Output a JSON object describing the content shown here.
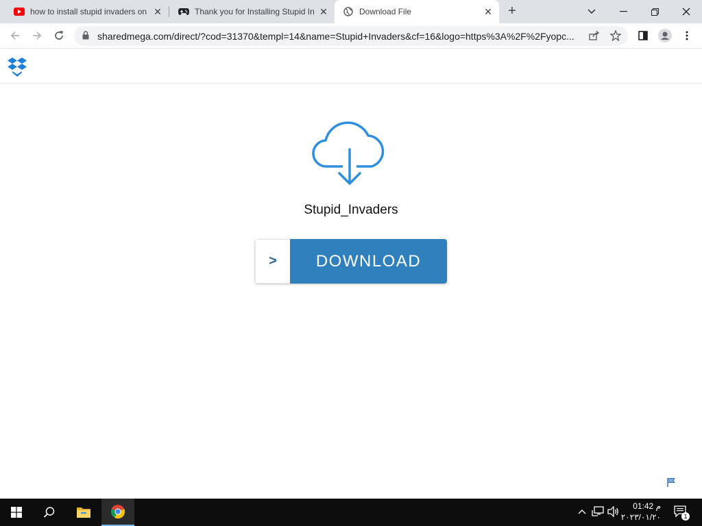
{
  "browser": {
    "tabs": [
      {
        "title": "how to install stupid invaders on",
        "icon": "youtube-icon",
        "active": false
      },
      {
        "title": "Thank you for Installing Stupid In",
        "icon": "gamepad-icon",
        "active": false
      },
      {
        "title": "Download File",
        "icon": "globe-icon",
        "active": true
      }
    ],
    "new_tab_label": "+",
    "url": "sharedmega.com/direct/?cod=31370&templ=14&name=Stupid+Invaders&cf=16&logo=https%3A%2F%2Fyopc..."
  },
  "page": {
    "logo_icon": "dropbox-icon",
    "file_name": "Stupid_Invaders",
    "download_arrow": ">",
    "download_label": "DOWNLOAD",
    "accent_color": "#2f80bd",
    "icon_color": "#2e8ee0"
  },
  "taskbar": {
    "time": "01:42 م",
    "date": "٢٠٢٣/٠١/٢٠",
    "notification_count": "1"
  }
}
